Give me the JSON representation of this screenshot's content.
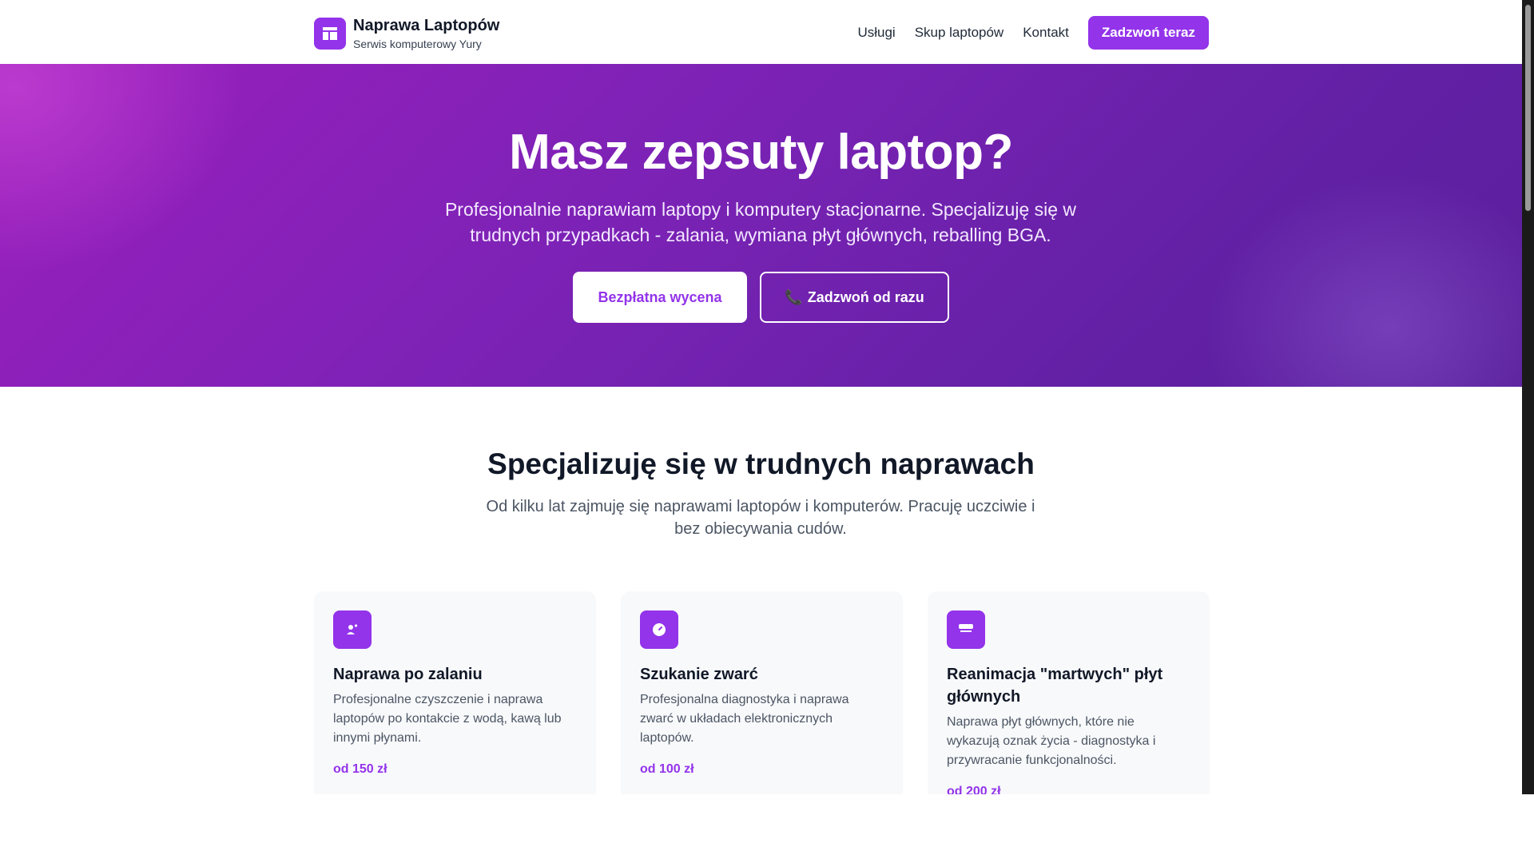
{
  "header": {
    "brand_title": "Naprawa Laptopów",
    "brand_subtitle": "Serwis komputerowy Yury",
    "nav": [
      "Usługi",
      "Skup laptopów",
      "Kontakt"
    ],
    "cta_label": "Zadzwoń teraz"
  },
  "hero": {
    "title": "Masz zepsuty laptop?",
    "text": "Profesjonalnie naprawiam laptopy i komputery stacjonarne. Specjalizuję się w trudnych przypadkach - zalania, wymiana płyt głównych, reballing BGA.",
    "primary_button": "Bezpłatna wycena",
    "secondary_button": "Zadzwoń od razu"
  },
  "services": {
    "title": "Specjalizuję się w trudnych naprawach",
    "text": "Od kilku lat zajmuję się naprawami laptopów i komputerów. Pracuję uczciwie i bez obiecywania cudów.",
    "cards": [
      {
        "title": "Naprawa po zalaniu",
        "desc": "Profesjonalne czyszczenie i naprawa laptopów po kontakcie z wodą, kawą lub innymi płynami.",
        "price": "od 150 zł",
        "icon": "droplet-user-icon"
      },
      {
        "title": "Szukanie zwarć",
        "desc": "Profesjonalna diagnostyka i naprawa zwarć w układach elektronicznych laptopów.",
        "price": "od 100 zł",
        "icon": "gauge-icon"
      },
      {
        "title": "Reanimacja \"martwych\" płyt głównych",
        "desc": "Naprawa płyt głównych, które nie wykazują oznak życia - diagnostyka i przywracanie funkcjonalności.",
        "price": "od 200 zł",
        "icon": "motherboard-icon"
      }
    ]
  },
  "colors": {
    "accent": "#9333ea",
    "hero_start": "#9b1fbd",
    "hero_end": "#5a1f9b"
  }
}
